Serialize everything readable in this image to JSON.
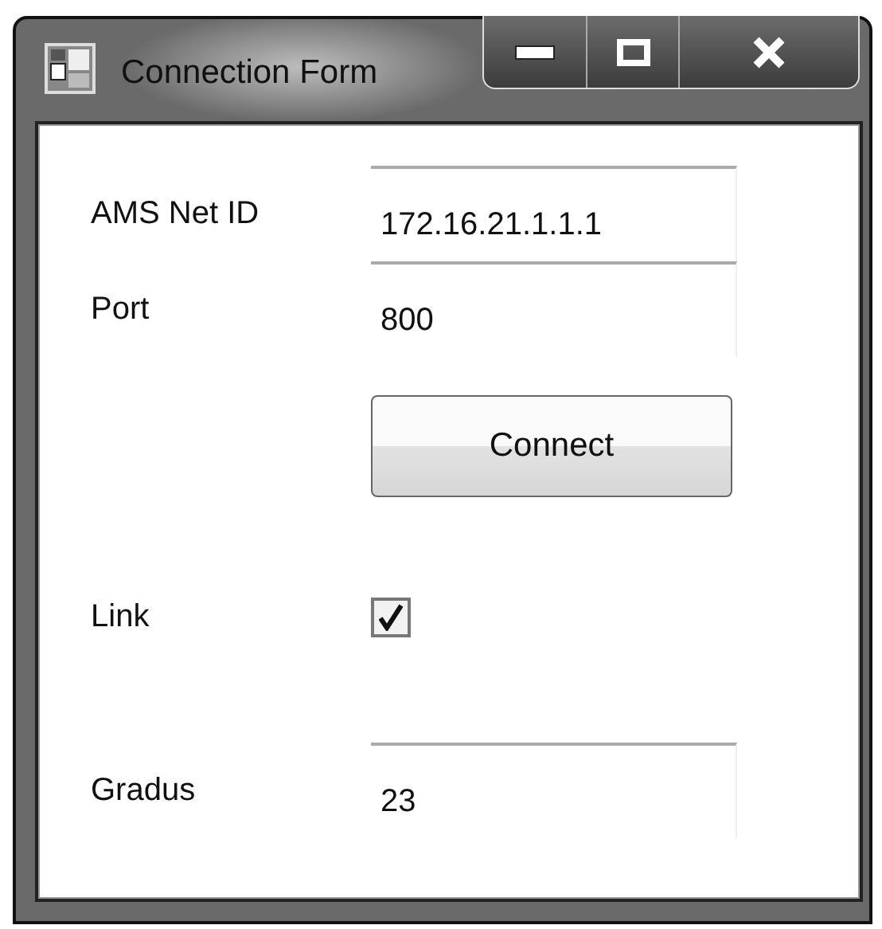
{
  "window": {
    "title": "Connection Form"
  },
  "rows": [
    {
      "kind": "text",
      "label": "AMS Net ID",
      "value": "172.16.21.1.1.1"
    },
    {
      "kind": "text",
      "label": "Port",
      "value": "800"
    },
    {
      "kind": "button",
      "label": "Connect"
    },
    {
      "kind": "checkbox",
      "label": "Link",
      "checked": true
    },
    {
      "kind": "text",
      "label": "Gradus",
      "value": "23"
    }
  ]
}
